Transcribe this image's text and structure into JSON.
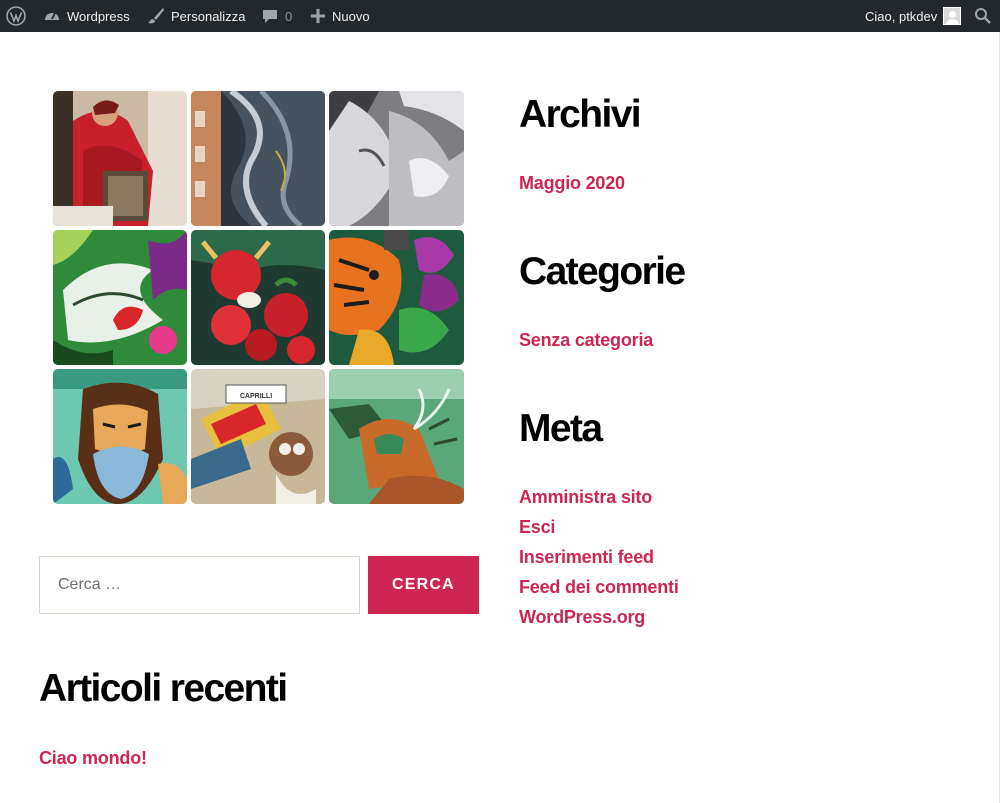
{
  "adminbar": {
    "wordpress_label": "Wordpress",
    "customize_label": "Personalizza",
    "comments_count": "0",
    "new_label": "Nuovo",
    "greeting": "Ciao, ptkdev"
  },
  "gallery": {
    "images": [
      {
        "icon": "mural-red-figure"
      },
      {
        "icon": "mural-smoky-building"
      },
      {
        "icon": "mural-gray-hands"
      },
      {
        "icon": "graffiti-green-monster"
      },
      {
        "icon": "graffiti-red-bull-tomatoes"
      },
      {
        "icon": "graffiti-tiger-flowers"
      },
      {
        "icon": "graffiti-bearded-character"
      },
      {
        "icon": "graffiti-street-sign-viale-caprilli"
      },
      {
        "icon": "graffiti-green-wall-figure"
      }
    ],
    "sign_text": "CAPRILLI"
  },
  "search": {
    "placeholder": "Cerca …",
    "button_label": "CERCA"
  },
  "recent_posts": {
    "title": "Articoli recenti",
    "items": [
      "Ciao mondo!"
    ]
  },
  "archives": {
    "title": "Archivi",
    "items": [
      "Maggio 2020"
    ]
  },
  "categories": {
    "title": "Categorie",
    "items": [
      "Senza categoria"
    ]
  },
  "meta": {
    "title": "Meta",
    "items": [
      "Amministra sito",
      "Esci",
      "Inserimenti feed",
      "Feed dei commenti",
      "WordPress.org"
    ]
  },
  "colors": {
    "accent": "#cd2653",
    "adminbar_bg": "#23282d"
  }
}
